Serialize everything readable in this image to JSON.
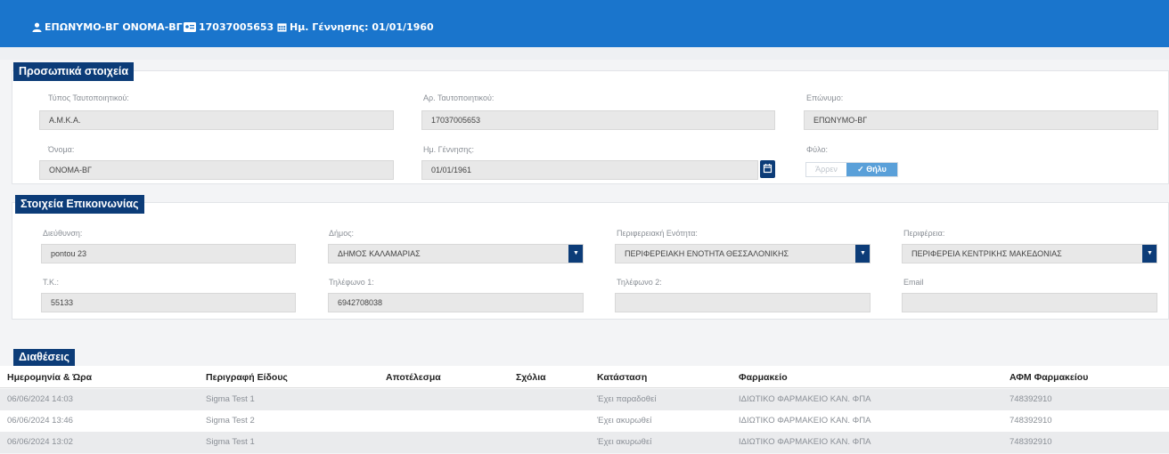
{
  "header": {
    "name": "ΕΠΩΝΥΜΟ-ΒΓ ΟΝΟΜΑ-ΒΓ",
    "id_number": "17037005653",
    "birthdate": "Ημ. Γέννησης: 01/01/1960"
  },
  "personal": {
    "title": "Προσωπικά στοιχεία",
    "id_type_label": "Τύπος Ταυτοποιητικού:",
    "id_type_value": "Α.Μ.Κ.Α.",
    "id_num_label": "Αρ. Ταυτοποιητικού:",
    "id_num_value": "17037005653",
    "surname_label": "Επώνυμο:",
    "surname_value": "ΕΠΩΝΥΜΟ-ΒΓ",
    "name_label": "Όνομα:",
    "name_value": "ΟΝΟΜΑ-ΒΓ",
    "birth_label": "Ημ. Γέννησης:",
    "birth_value": "01/01/1961",
    "sex_label": "Φύλο:",
    "sex_options": [
      "Άρρεν",
      "Θήλυ"
    ],
    "sex_selected": "Θήλυ"
  },
  "contact": {
    "title": "Στοιχεία Επικοινωνίας",
    "address_label": "Διεύθυνση:",
    "address_value": "pontou 23",
    "municipality_label": "Δήμος:",
    "municipality_value": "ΔΗΜΟΣ ΚΑΛΑΜΑΡΙΑΣ",
    "regional_unit_label": "Περιφερειακή Ενότητα:",
    "regional_unit_value": "ΠΕΡΙΦΕΡΕΙΑΚΗ ΕΝΟΤΗΤΑ ΘΕΣΣΑΛΟΝΙΚΗΣ",
    "region_label": "Περιφέρεια:",
    "region_value": "ΠΕΡΙΦΕΡΕΙΑ ΚΕΝΤΡΙΚΗΣ ΜΑΚΕΔΟΝΙΑΣ",
    "postal_label": "Τ.Κ.:",
    "postal_value": "55133",
    "phone1_label": "Τηλέφωνο 1:",
    "phone1_value": "6942708038",
    "phone2_label": "Τηλέφωνο 2:",
    "phone2_value": "",
    "email_label": "Email",
    "email_value": ""
  },
  "dispositions": {
    "title": "Διαθέσεις",
    "columns": [
      "Ημερομηνία & Ώρα",
      "Περιγραφή Είδους",
      "Αποτέλεσμα",
      "Σχόλια",
      "Κατάσταση",
      "Φαρμακείο",
      "ΑΦΜ Φαρμακείου"
    ],
    "rows": [
      [
        "06/06/2024 14:03",
        "Sigma Test 1",
        "",
        "",
        "Έχει παραδοθεί",
        "ΙΔΙΩΤΙΚΟ ΦΑΡΜΑΚΕΙΟ ΚΑΝ. ΦΠΑ",
        "748392910"
      ],
      [
        "06/06/2024 13:46",
        "Sigma Test 2",
        "",
        "",
        "Έχει ακυρωθεί",
        "ΙΔΙΩΤΙΚΟ ΦΑΡΜΑΚΕΙΟ ΚΑΝ. ΦΠΑ",
        "748392910"
      ],
      [
        "06/06/2024 13:02",
        "Sigma Test 1",
        "",
        "",
        "Έχει ακυρωθεί",
        "ΙΔΙΩΤΙΚΟ ΦΑΡΜΑΚΕΙΟ ΚΑΝ. ΦΠΑ",
        "748392910"
      ]
    ]
  },
  "colors": {
    "header_bg": "#1a75cc",
    "section_bg": "#0c3c78",
    "toggle_active": "#5aa0d9"
  },
  "icons": [
    "user-icon",
    "id-card-icon",
    "calendar-icon",
    "caret-down-icon",
    "check-icon"
  ]
}
